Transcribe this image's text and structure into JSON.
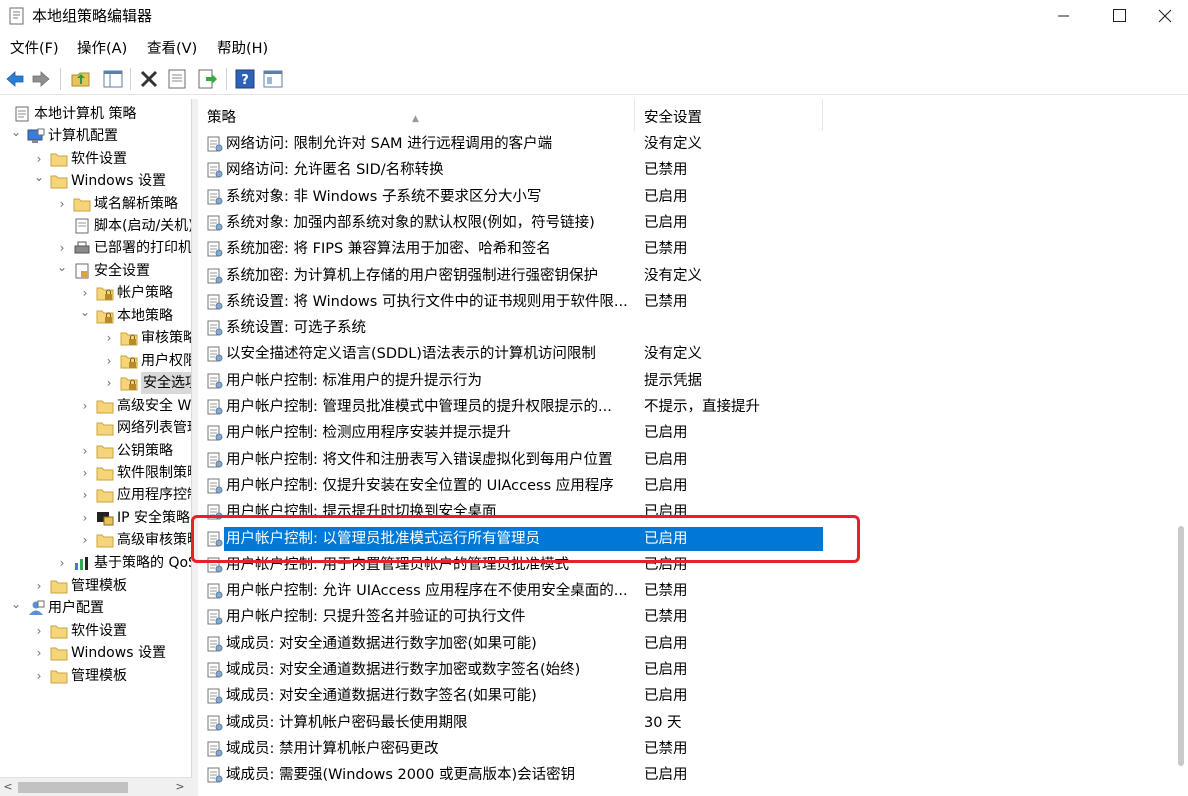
{
  "window": {
    "title": "本地组策略编辑器"
  },
  "menu": [
    "文件(F)",
    "操作(A)",
    "查看(V)",
    "帮助(H)"
  ],
  "toolbar": {
    "icons": [
      "back-icon",
      "forward-icon",
      "up-folder-icon",
      "show-hide-tree-icon",
      "delete-icon",
      "properties-icon",
      "export-icon",
      "help-icon",
      "view-icon"
    ]
  },
  "tree": {
    "items": [
      {
        "label": "本地计算机 策略",
        "icon": "policy-doc-icon"
      },
      {
        "label": "计算机配置",
        "icon": "computer-icon"
      },
      {
        "label": "软件设置",
        "icon": "folder-icon"
      },
      {
        "label": "Windows 设置",
        "icon": "folder-icon"
      },
      {
        "label": "域名解析策略",
        "icon": "folder-icon"
      },
      {
        "label": "脚本(启动/关机)",
        "icon": "script-icon"
      },
      {
        "label": "已部署的打印机",
        "icon": "printer-icon"
      },
      {
        "label": "安全设置",
        "icon": "security-icon"
      },
      {
        "label": "帐户策略",
        "icon": "locked-folder-icon"
      },
      {
        "label": "本地策略",
        "icon": "locked-folder-icon"
      },
      {
        "label": "审核策略",
        "icon": "locked-folder-icon"
      },
      {
        "label": "用户权限分配",
        "icon": "locked-folder-icon"
      },
      {
        "label": "安全选项",
        "icon": "locked-folder-icon"
      },
      {
        "label": "高级安全 Windows Defender 防火墙",
        "icon": "folder-icon"
      },
      {
        "label": "网络列表管理器策略",
        "icon": "folder-icon"
      },
      {
        "label": "公钥策略",
        "icon": "folder-icon"
      },
      {
        "label": "软件限制策略",
        "icon": "folder-icon"
      },
      {
        "label": "应用程序控制策略",
        "icon": "folder-icon"
      },
      {
        "label": "IP 安全策略，在 本地计算机",
        "icon": "ip-security-icon"
      },
      {
        "label": "高级审核策略配置",
        "icon": "folder-icon"
      },
      {
        "label": "基于策略的 QoS",
        "icon": "chart-icon"
      },
      {
        "label": "管理模板",
        "icon": "folder-icon"
      },
      {
        "label": "用户配置",
        "icon": "user-icon"
      },
      {
        "label": "软件设置",
        "icon": "folder-icon"
      },
      {
        "label": "Windows 设置",
        "icon": "folder-icon"
      },
      {
        "label": "管理模板",
        "icon": "folder-icon"
      }
    ]
  },
  "list": {
    "columns": [
      "策略",
      "安全设置"
    ],
    "rows": [
      {
        "name": "网络访问: 限制允许对 SAM 进行远程调用的客户端",
        "value": "没有定义"
      },
      {
        "name": "网络访问: 允许匿名 SID/名称转换",
        "value": "已禁用"
      },
      {
        "name": "系统对象: 非 Windows 子系统不要求区分大小写",
        "value": "已启用"
      },
      {
        "name": "系统对象: 加强内部系统对象的默认权限(例如，符号链接)",
        "value": "已启用"
      },
      {
        "name": "系统加密: 将 FIPS 兼容算法用于加密、哈希和签名",
        "value": "已禁用"
      },
      {
        "name": "系统加密: 为计算机上存储的用户密钥强制进行强密钥保护",
        "value": "没有定义"
      },
      {
        "name": "系统设置: 将 Windows 可执行文件中的证书规则用于软件限...",
        "value": "已禁用"
      },
      {
        "name": "系统设置: 可选子系统",
        "value": ""
      },
      {
        "name": "以安全描述符定义语言(SDDL)语法表示的计算机访问限制",
        "value": "没有定义"
      },
      {
        "name": "用户帐户控制: 标准用户的提升提示行为",
        "value": "提示凭据"
      },
      {
        "name": "用户帐户控制: 管理员批准模式中管理员的提升权限提示的...",
        "value": "不提示，直接提升"
      },
      {
        "name": "用户帐户控制: 检测应用程序安装并提示提升",
        "value": "已启用"
      },
      {
        "name": "用户帐户控制: 将文件和注册表写入错误虚拟化到每用户位置",
        "value": "已启用"
      },
      {
        "name": "用户帐户控制: 仅提升安装在安全位置的 UIAccess 应用程序",
        "value": "已启用"
      },
      {
        "name": "用户帐户控制: 提示提升时切换到安全桌面",
        "value": "已启用"
      },
      {
        "name": "用户帐户控制: 以管理员批准模式运行所有管理员",
        "value": "已启用"
      },
      {
        "name": "用户帐户控制: 用于内置管理员帐户的管理员批准模式",
        "value": "已启用"
      },
      {
        "name": "用户帐户控制: 允许 UIAccess 应用程序在不使用安全桌面的...",
        "value": "已禁用"
      },
      {
        "name": "用户帐户控制: 只提升签名并验证的可执行文件",
        "value": "已禁用"
      },
      {
        "name": "域成员: 对安全通道数据进行数字加密(如果可能)",
        "value": "已启用"
      },
      {
        "name": "域成员: 对安全通道数据进行数字加密或数字签名(始终)",
        "value": "已启用"
      },
      {
        "name": "域成员: 对安全通道数据进行数字签名(如果可能)",
        "value": "已启用"
      },
      {
        "name": "域成员: 计算机帐户密码最长使用期限",
        "value": "30 天"
      },
      {
        "name": "域成员: 禁用计算机帐户密码更改",
        "value": "已禁用"
      },
      {
        "name": "域成员: 需要强(Windows 2000 或更高版本)会话密钥",
        "value": "已启用"
      }
    ],
    "selected_index": 15
  },
  "colors": {
    "selection": "#0078d7",
    "annotation": "#e8202a"
  }
}
